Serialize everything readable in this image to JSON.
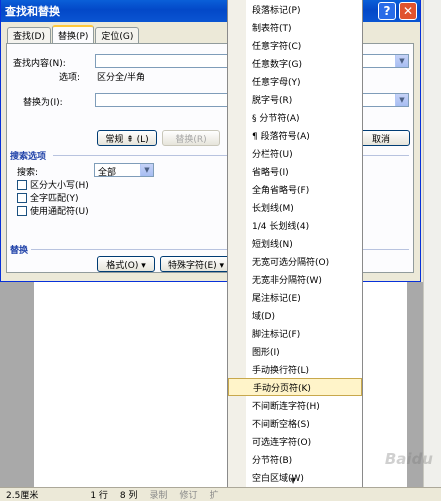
{
  "dialog": {
    "title": "查找和替换",
    "tabs": [
      "查找(D)",
      "替换(P)",
      "定位(G)"
    ],
    "find_label": "查找内容(N):",
    "options_label": "选项:",
    "options_value": "区分全/半角",
    "replace_label": "替换为(I):",
    "buttons": {
      "less": "常规 ⇞ (L)",
      "replace": "替换(R)",
      "cancel": "取消"
    },
    "search_options_title": "搜索选项",
    "search_label": "搜索:",
    "search_value": "全部",
    "checkboxes": [
      "区分大小写(H)",
      "全字匹配(Y)",
      "使用通配符(U)"
    ],
    "replace_section_title": "替换",
    "format_button": "格式(O) ▾",
    "special_button": "特殊字符(E) ▾"
  },
  "menu": {
    "items": [
      "段落标记(P)",
      "制表符(T)",
      "任意字符(C)",
      "任意数字(G)",
      "任意字母(Y)",
      "脱字号(R)",
      "§ 分节符(A)",
      "¶ 段落符号(A)",
      "分栏符(U)",
      "省略号(I)",
      "全角省略号(F)",
      "长划线(M)",
      "1/4 长划线(4)",
      "短划线(N)",
      "无宽可选分隔符(O)",
      "无宽非分隔符(W)",
      "尾注标记(E)",
      "域(D)",
      "脚注标记(F)",
      "图形(I)",
      "手动换行符(L)",
      "手动分页符(K)",
      "不间断连字符(H)",
      "不间断空格(S)",
      "可选连字符(O)",
      "分节符(B)",
      "空白区域(W)"
    ],
    "highlighted": "手动分页符(K)"
  },
  "status": {
    "position": "2.5厘米",
    "line": "1 行",
    "col": "8 列",
    "rec": "录制",
    "trk": "修订",
    "ext": "扩"
  },
  "watermark": "Baidu"
}
